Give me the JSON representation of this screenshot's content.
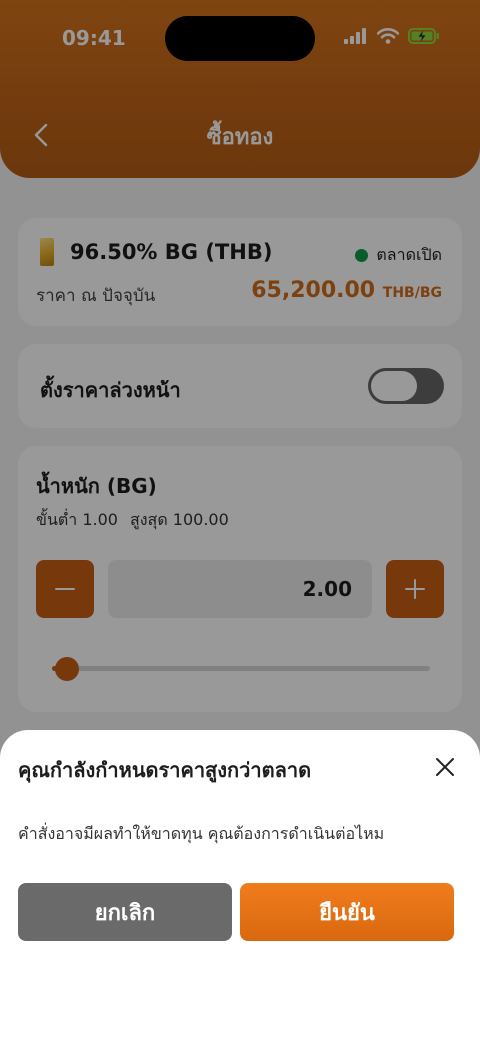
{
  "status_bar": {
    "time": "09:41"
  },
  "header": {
    "title": "ซื้อทอง"
  },
  "price_card": {
    "product_name": "96.50% BG (THB)",
    "market_status": "ตลาดเปิด",
    "price_label": "ราคา ณ ปัจจุบัน",
    "price_value": "65,200.00",
    "price_unit": "THB/BG"
  },
  "advance_card": {
    "label": "ตั้งราคาล่วงหน้า",
    "toggle_on": false
  },
  "weight_card": {
    "title": "น้ำหนัก (BG)",
    "min_text": "ขั้นต่ำ 1.00",
    "max_text": "สูงสุด 100.00",
    "value": "2.00",
    "slider_fraction": 0.04
  },
  "dialog": {
    "title": "คุณกำลังกำหนดราคาสูงกว่าตลาด",
    "message": "คำสั่งอาจมีผลทำให้ขาดทุน คุณต้องการดำเนินต่อไหม",
    "cancel_label": "ยกเลิก",
    "confirm_label": "ยืนยัน"
  },
  "colors": {
    "accent": "#c65f14",
    "header": "#c06418",
    "market_open": "#0f9b46",
    "price": "#d06d1a",
    "cancel": "#6a6a6a"
  }
}
